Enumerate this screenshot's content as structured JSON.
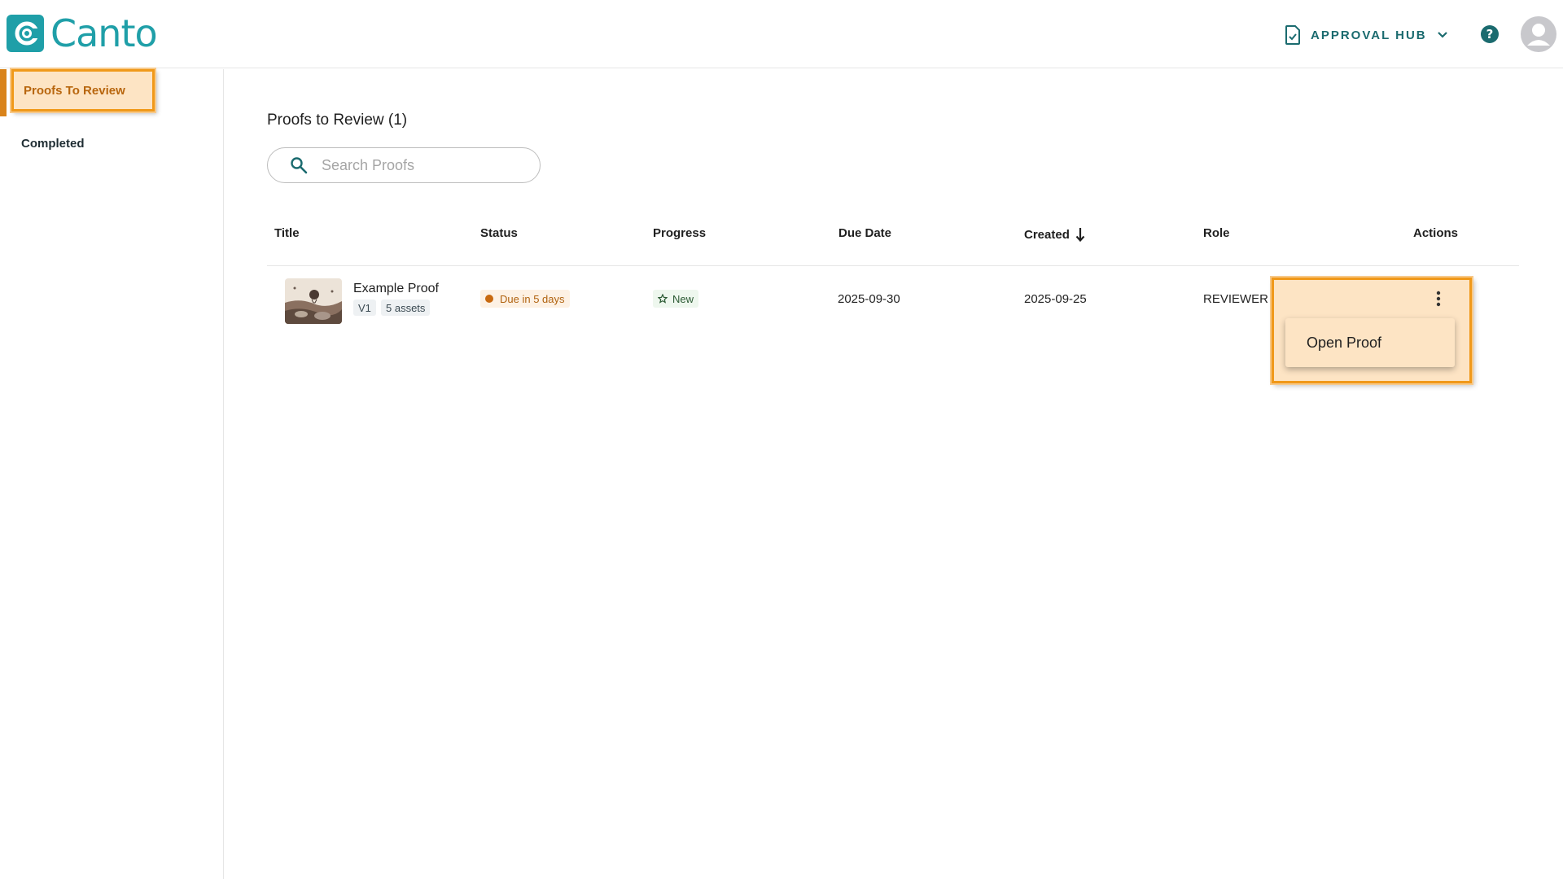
{
  "header": {
    "logo_text": "Canto",
    "hub_label": "APPROVAL HUB",
    "brand_color": "#1f9fa8"
  },
  "sidebar": {
    "items": [
      {
        "label": "Proofs To Review",
        "active": true
      },
      {
        "label": "Completed",
        "active": false
      }
    ]
  },
  "main": {
    "title": "Proofs to Review (1)",
    "search": {
      "placeholder": "Search Proofs",
      "value": ""
    },
    "columns": [
      "Title",
      "Status",
      "Progress",
      "Due Date",
      "Created",
      "Role",
      "Actions"
    ],
    "sort": {
      "column": "Created",
      "direction": "descending"
    },
    "rows": [
      {
        "title": "Example Proof",
        "version": "V1",
        "assets": "5 assets",
        "status": "Due in 5 days",
        "progress": "New",
        "due_date": "2025-09-30",
        "created": "2025-09-25",
        "role": "REVIEWER"
      }
    ],
    "actions_menu": {
      "items": [
        "Open Proof"
      ]
    }
  },
  "icons": {
    "hub": "document-check-icon",
    "hub_toggle": "chevron-down-icon",
    "help": "help-icon",
    "avatar": "user-avatar-icon",
    "search": "search-icon",
    "sort": "arrow-down-icon",
    "progress": "star-outline-icon",
    "actions": "more-vertical-icon"
  },
  "colors": {
    "highlight_fill": "#fde4c4",
    "highlight_border": "#f0991a",
    "status": "#c8690f",
    "teal_text": "#1b6b6f"
  }
}
